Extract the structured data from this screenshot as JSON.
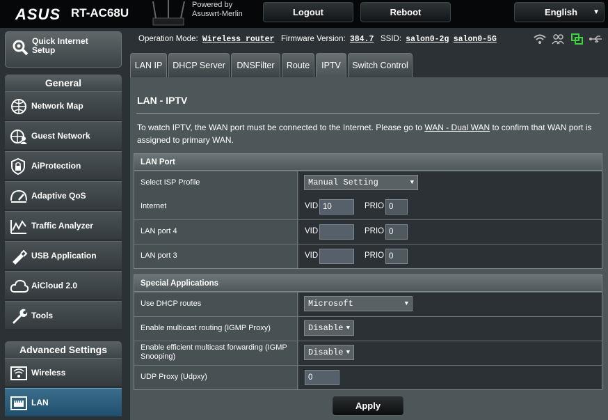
{
  "header": {
    "brand": "ASUS",
    "model": "RT-AC68U",
    "powered_by_line1": "Powered by",
    "powered_by_line2": "Asuswrt-Merlin",
    "logout_label": "Logout",
    "reboot_label": "Reboot",
    "language": "English"
  },
  "sidebar": {
    "quick_setup_line1": "Quick Internet",
    "quick_setup_line2": "Setup",
    "general_title": "General",
    "general_items": [
      {
        "label": "Network Map",
        "icon": "network-map-icon"
      },
      {
        "label": "Guest Network",
        "icon": "guest-network-icon"
      },
      {
        "label": "AiProtection",
        "icon": "shield-icon"
      },
      {
        "label": "Adaptive QoS",
        "icon": "speedometer-icon"
      },
      {
        "label": "Traffic Analyzer",
        "icon": "traffic-chart-icon"
      },
      {
        "label": "USB Application",
        "icon": "usb-puzzle-icon"
      },
      {
        "label": "AiCloud 2.0",
        "icon": "cloud-icon"
      },
      {
        "label": "Tools",
        "icon": "wrench-icon"
      }
    ],
    "advanced_title": "Advanced Settings",
    "advanced_items": [
      {
        "label": "Wireless",
        "icon": "wireless-icon"
      },
      {
        "label": "LAN",
        "icon": "lan-icon",
        "active": true
      }
    ]
  },
  "status": {
    "op_mode_label": "Operation Mode:",
    "op_mode": "Wireless router",
    "firmware_label": "Firmware Version:",
    "firmware": "384.7",
    "ssid_label": "SSID:",
    "ssid_1": "salon0-2g",
    "ssid_2": "salon0-5G"
  },
  "tabs": [
    "LAN IP",
    "DHCP Server",
    "DNSFilter",
    "Route",
    "IPTV",
    "Switch Control"
  ],
  "active_tab": "IPTV",
  "page": {
    "title": "LAN - IPTV",
    "desc_before": "To watch IPTV, the WAN port must be connected to the Internet. Please go to ",
    "desc_link": "WAN - Dual WAN",
    "desc_after": " to confirm that WAN port is assigned to primary WAN."
  },
  "lan_port": {
    "header": "LAN Port",
    "isp_profile_label": "Select ISP Profile",
    "isp_profile_value": "Manual Setting",
    "vid_label": "VID",
    "prio_label": "PRIO",
    "rows": [
      {
        "label": "Internet",
        "vid": "10",
        "prio": "0"
      },
      {
        "label": "LAN port 4",
        "vid": "",
        "prio": "0"
      },
      {
        "label": "LAN port 3",
        "vid": "",
        "prio": "0"
      }
    ]
  },
  "special": {
    "header": "Special Applications",
    "dhcp_routes_label": "Use DHCP routes",
    "dhcp_routes_value": "Microsoft",
    "igmp_proxy_label": "Enable multicast routing (IGMP Proxy)",
    "igmp_proxy_value": "Disable",
    "igmp_snoop_label": "Enable efficient multicast forwarding (IGMP Snooping)",
    "igmp_snoop_value": "Disable",
    "udpxy_label": "UDP Proxy (Udpxy)",
    "udpxy_value": "0"
  },
  "apply_label": "Apply",
  "colors": {
    "top_bar": "#050708",
    "panel": "#4d5659",
    "active_menu": "#2f6283"
  }
}
